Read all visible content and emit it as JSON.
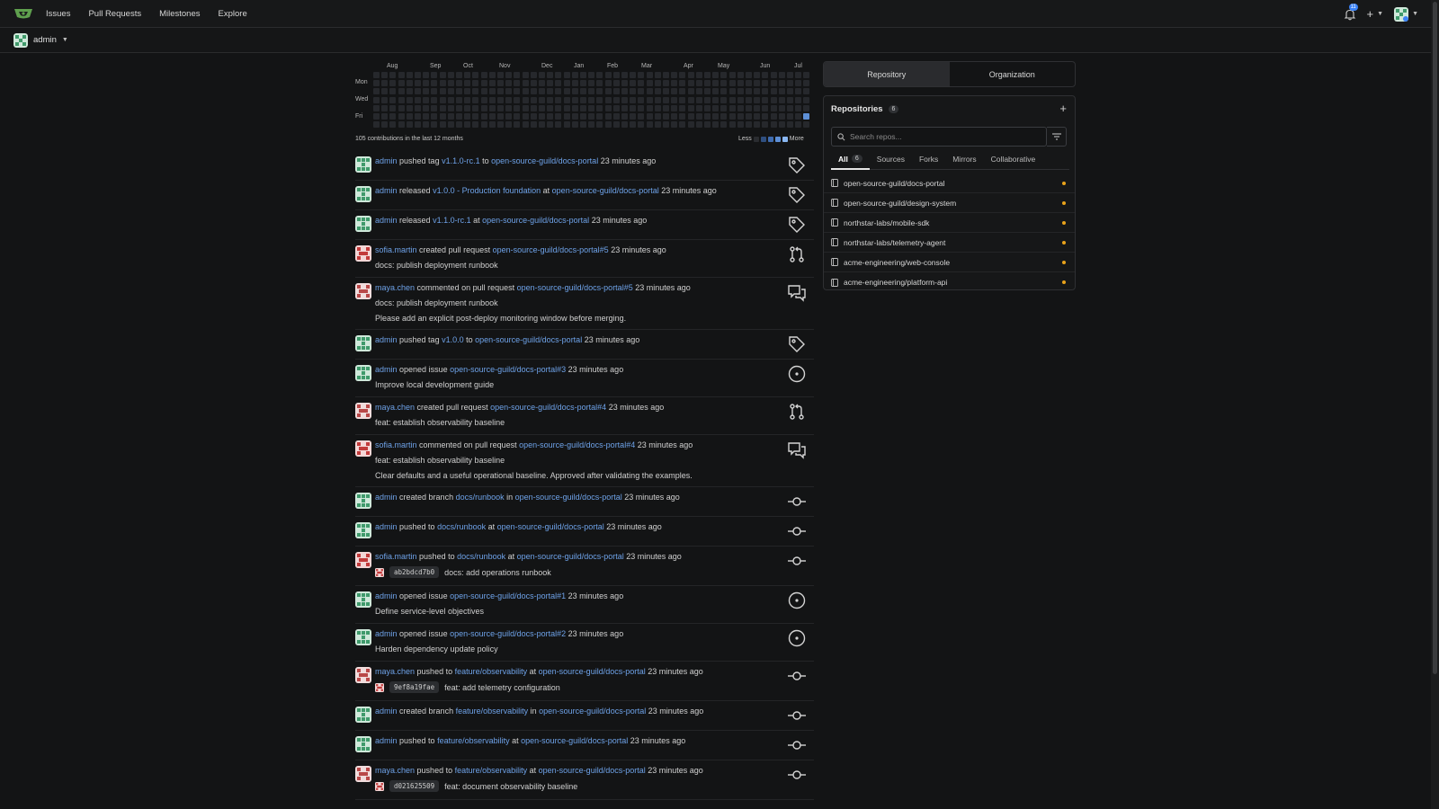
{
  "nav": {
    "links": [
      "Issues",
      "Pull Requests",
      "Milestones",
      "Explore"
    ],
    "notification_count": "11",
    "plus_label": "+"
  },
  "context": {
    "user": "admin"
  },
  "heatmap": {
    "months": [
      "Aug",
      "Sep",
      "Oct",
      "Nov",
      "Dec",
      "Jan",
      "Feb",
      "Mar",
      "Apr",
      "May",
      "Jun",
      "Jul"
    ],
    "days": [
      "Mon",
      "Wed",
      "Fri"
    ],
    "summary": "105 contributions in the last 12 months",
    "legend_less": "Less",
    "legend_more": "More",
    "colors": {
      "empty": "#26282c",
      "level1": "#5d8fd6"
    }
  },
  "feed": [
    {
      "actor": "admin",
      "av": "green",
      "icon": "tag-icon",
      "parts": [
        [
          "t",
          "pushed tag "
        ],
        [
          "l",
          "v1.1.0-rc.1"
        ],
        [
          "t",
          " to "
        ],
        [
          "l",
          "open-source-guild/docs-portal"
        ],
        [
          "t",
          " 23 minutes ago"
        ]
      ]
    },
    {
      "actor": "admin",
      "av": "green",
      "icon": "tag-icon",
      "parts": [
        [
          "t",
          "released "
        ],
        [
          "l",
          "v1.0.0 - Production foundation"
        ],
        [
          "t",
          " at "
        ],
        [
          "l",
          "open-source-guild/docs-portal"
        ],
        [
          "t",
          " 23 minutes ago"
        ]
      ]
    },
    {
      "actor": "admin",
      "av": "green",
      "icon": "tag-icon",
      "parts": [
        [
          "t",
          "released "
        ],
        [
          "l",
          "v1.1.0-rc.1"
        ],
        [
          "t",
          " at "
        ],
        [
          "l",
          "open-source-guild/docs-portal"
        ],
        [
          "t",
          " 23 minutes ago"
        ]
      ]
    },
    {
      "actor": "sofia.martin",
      "av": "red",
      "icon": "pull-request-icon",
      "parts": [
        [
          "t",
          "created pull request "
        ],
        [
          "l",
          "open-source-guild/docs-portal#5"
        ],
        [
          "t",
          " 23 minutes ago"
        ]
      ],
      "sub": "docs: publish deployment runbook"
    },
    {
      "actor": "maya.chen",
      "av": "red2",
      "icon": "comment-icon",
      "parts": [
        [
          "t",
          "commented on pull request "
        ],
        [
          "l",
          "open-source-guild/docs-portal#5"
        ],
        [
          "t",
          " 23 minutes ago"
        ]
      ],
      "sublink": "docs: publish deployment runbook",
      "body": "Please add an explicit post-deploy monitoring window before merging."
    },
    {
      "actor": "admin",
      "av": "green",
      "icon": "tag-icon",
      "parts": [
        [
          "t",
          "pushed tag "
        ],
        [
          "l",
          "v1.0.0"
        ],
        [
          "t",
          " to "
        ],
        [
          "l",
          "open-source-guild/docs-portal"
        ],
        [
          "t",
          " 23 minutes ago"
        ]
      ]
    },
    {
      "actor": "admin",
      "av": "green",
      "icon": "issue-icon",
      "parts": [
        [
          "t",
          "opened issue "
        ],
        [
          "l",
          "open-source-guild/docs-portal#3"
        ],
        [
          "t",
          " 23 minutes ago"
        ]
      ],
      "sub": "Improve local development guide"
    },
    {
      "actor": "maya.chen",
      "av": "red2",
      "icon": "pull-request-icon",
      "parts": [
        [
          "t",
          "created pull request "
        ],
        [
          "l",
          "open-source-guild/docs-portal#4"
        ],
        [
          "t",
          " 23 minutes ago"
        ]
      ],
      "sub": "feat: establish observability baseline"
    },
    {
      "actor": "sofia.martin",
      "av": "red",
      "icon": "comment-icon",
      "parts": [
        [
          "t",
          "commented on pull request "
        ],
        [
          "l",
          "open-source-guild/docs-portal#4"
        ],
        [
          "t",
          " 23 minutes ago"
        ]
      ],
      "sublink": "feat: establish observability baseline",
      "body": "Clear defaults and a useful operational baseline. Approved after validating the examples."
    },
    {
      "actor": "admin",
      "av": "green",
      "icon": "commit-icon",
      "parts": [
        [
          "t",
          "created branch "
        ],
        [
          "l",
          "docs/runbook"
        ],
        [
          "t",
          " in "
        ],
        [
          "l",
          "open-source-guild/docs-portal"
        ],
        [
          "t",
          " 23 minutes ago"
        ]
      ]
    },
    {
      "actor": "admin",
      "av": "green",
      "icon": "commit-icon",
      "parts": [
        [
          "t",
          "pushed to "
        ],
        [
          "l",
          "docs/runbook"
        ],
        [
          "t",
          " at "
        ],
        [
          "l",
          "open-source-guild/docs-portal"
        ],
        [
          "t",
          " 23 minutes ago"
        ]
      ]
    },
    {
      "actor": "sofia.martin",
      "av": "red",
      "icon": "commit-icon",
      "parts": [
        [
          "t",
          "pushed to "
        ],
        [
          "l",
          "docs/runbook"
        ],
        [
          "t",
          " at "
        ],
        [
          "l",
          "open-source-guild/docs-portal"
        ],
        [
          "t",
          " 23 minutes ago"
        ]
      ],
      "commit": {
        "sha": "ab2bdcd7b0",
        "msg": "docs: add operations runbook"
      }
    },
    {
      "actor": "admin",
      "av": "green",
      "icon": "issue-icon",
      "parts": [
        [
          "t",
          "opened issue "
        ],
        [
          "l",
          "open-source-guild/docs-portal#1"
        ],
        [
          "t",
          " 23 minutes ago"
        ]
      ],
      "sub": "Define service-level objectives"
    },
    {
      "actor": "admin",
      "av": "green",
      "icon": "issue-icon",
      "parts": [
        [
          "t",
          "opened issue "
        ],
        [
          "l",
          "open-source-guild/docs-portal#2"
        ],
        [
          "t",
          " 23 minutes ago"
        ]
      ],
      "sub": "Harden dependency update policy"
    },
    {
      "actor": "maya.chen",
      "av": "red2",
      "icon": "commit-icon",
      "parts": [
        [
          "t",
          "pushed to "
        ],
        [
          "l",
          "feature/observability"
        ],
        [
          "t",
          " at "
        ],
        [
          "l",
          "open-source-guild/docs-portal"
        ],
        [
          "t",
          " 23 minutes ago"
        ]
      ],
      "commit": {
        "sha": "9ef8a19fae",
        "msg": "feat: add telemetry configuration"
      }
    },
    {
      "actor": "admin",
      "av": "green",
      "icon": "commit-icon",
      "parts": [
        [
          "t",
          "created branch "
        ],
        [
          "l",
          "feature/observability"
        ],
        [
          "t",
          " in "
        ],
        [
          "l",
          "open-source-guild/docs-portal"
        ],
        [
          "t",
          " 23 minutes ago"
        ]
      ]
    },
    {
      "actor": "admin",
      "av": "green",
      "icon": "commit-icon",
      "parts": [
        [
          "t",
          "pushed to "
        ],
        [
          "l",
          "feature/observability"
        ],
        [
          "t",
          " at "
        ],
        [
          "l",
          "open-source-guild/docs-portal"
        ],
        [
          "t",
          " 23 minutes ago"
        ]
      ]
    },
    {
      "actor": "maya.chen",
      "av": "red2",
      "icon": "commit-icon",
      "parts": [
        [
          "t",
          "pushed to "
        ],
        [
          "l",
          "feature/observability"
        ],
        [
          "t",
          " at "
        ],
        [
          "l",
          "open-source-guild/docs-portal"
        ],
        [
          "t",
          " 23 minutes ago"
        ]
      ],
      "commit": {
        "sha": "d021625509",
        "msg": "feat: document observability baseline"
      }
    }
  ],
  "panel": {
    "switch": [
      "Repository",
      "Organization"
    ],
    "title": "Repositories",
    "count": "6",
    "search_placeholder": "Search repos...",
    "tabs": [
      {
        "label": "All",
        "count": "6"
      },
      {
        "label": "Sources"
      },
      {
        "label": "Forks"
      },
      {
        "label": "Mirrors"
      },
      {
        "label": "Collaborative"
      }
    ],
    "repos": [
      "open-source-guild/docs-portal",
      "open-source-guild/design-system",
      "northstar-labs/mobile-sdk",
      "northstar-labs/telemetry-agent",
      "acme-engineering/web-console",
      "acme-engineering/platform-api"
    ]
  }
}
